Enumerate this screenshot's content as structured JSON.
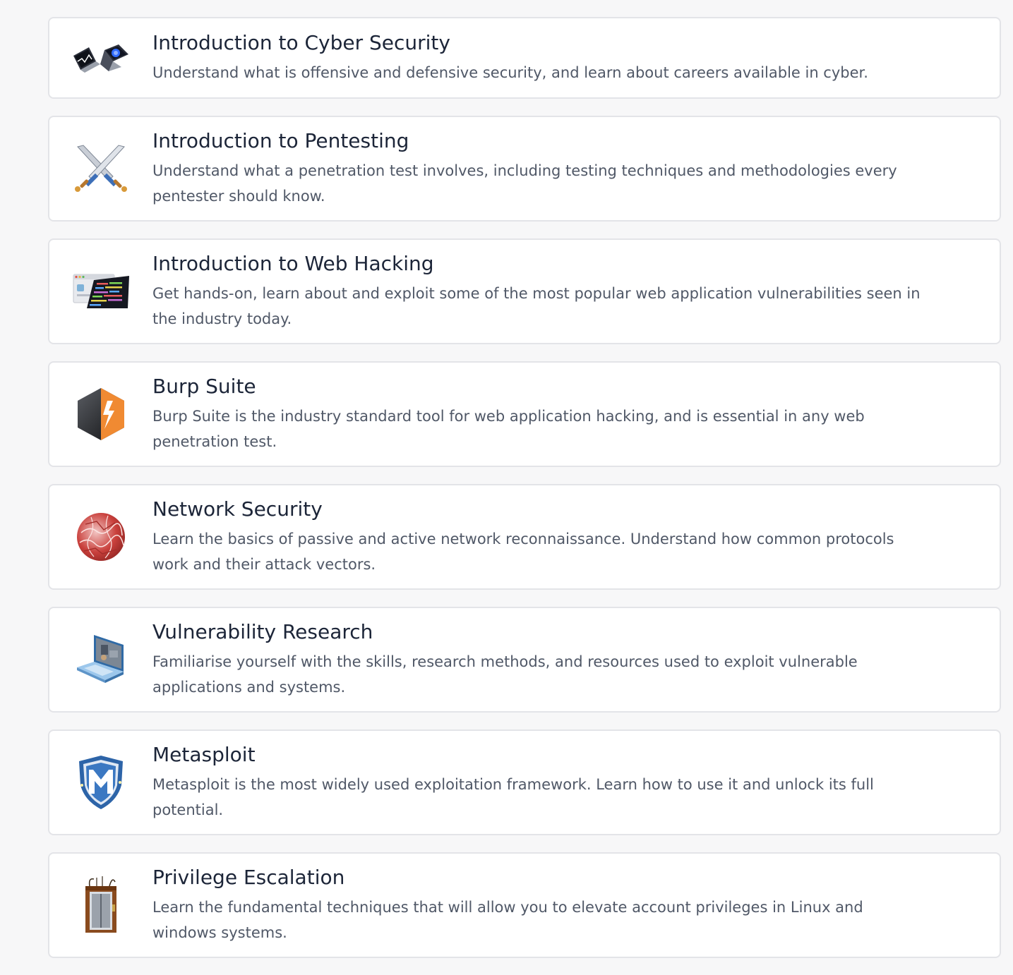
{
  "modules": [
    {
      "icon": "laptops-icon",
      "title": "Introduction to Cyber Security",
      "description": "Understand what is offensive and defensive security, and learn about careers available in cyber."
    },
    {
      "icon": "crossed-swords-icon",
      "title": "Introduction to Pentesting",
      "description": "Understand what a penetration test involves, including testing techniques and methodologies every pentester should know."
    },
    {
      "icon": "web-code-window-icon",
      "title": "Introduction to Web Hacking",
      "description": "Get hands-on, learn about and exploit some of the most popular web application vulnerabilities seen in the industry today."
    },
    {
      "icon": "burp-suite-icon",
      "title": "Burp Suite",
      "description": "Burp Suite is the industry standard tool for web application hacking, and is essential in any web penetration test."
    },
    {
      "icon": "network-globe-icon",
      "title": "Network Security",
      "description": "Learn the basics of passive and active network reconnaissance. Understand how common protocols work and their attack vectors."
    },
    {
      "icon": "research-laptop-icon",
      "title": "Vulnerability Research",
      "description": "Familiarise yourself with the skills, research methods, and resources used to exploit vulnerable applications and systems."
    },
    {
      "icon": "metasploit-shield-icon",
      "title": "Metasploit",
      "description": "Metasploit is the most widely used exploitation framework. Learn how to use it and unlock its full potential."
    },
    {
      "icon": "elevator-icon",
      "title": "Privilege Escalation",
      "description": "Learn the fundamental techniques that will allow you to elevate account privileges in Linux and windows systems."
    }
  ]
}
